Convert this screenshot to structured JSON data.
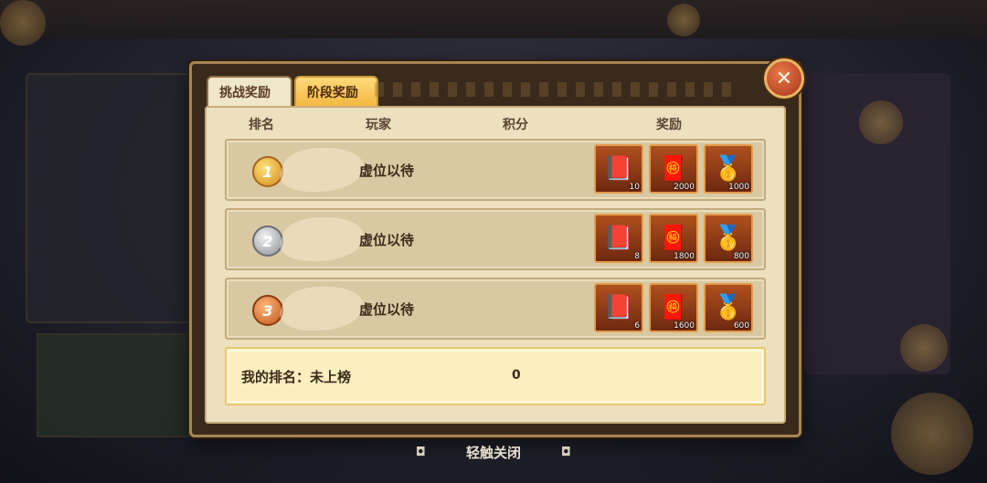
{
  "dialog": {
    "tabs": [
      {
        "label": "挑战奖励",
        "active": false
      },
      {
        "label": "阶段奖励",
        "active": true
      }
    ],
    "close_icon": "close-x-icon"
  },
  "table": {
    "headers": {
      "rank": "排名",
      "player": "玩家",
      "score": "积分",
      "reward": "奖励"
    },
    "rows": [
      {
        "rank": "1",
        "medal": "gold",
        "player": "虚位以待",
        "rewards": [
          {
            "icon": "book-icon",
            "count": "10"
          },
          {
            "icon": "red-envelope-icon",
            "count": "2000"
          },
          {
            "icon": "gold-ingot-icon",
            "count": "1000"
          }
        ]
      },
      {
        "rank": "2",
        "medal": "silver",
        "player": "虚位以待",
        "rewards": [
          {
            "icon": "book-icon",
            "count": "8"
          },
          {
            "icon": "red-envelope-icon",
            "count": "1800"
          },
          {
            "icon": "gold-ingot-icon",
            "count": "800"
          }
        ]
      },
      {
        "rank": "3",
        "medal": "bronze",
        "player": "虚位以待",
        "rewards": [
          {
            "icon": "book-icon",
            "count": "6"
          },
          {
            "icon": "red-envelope-icon",
            "count": "1600"
          },
          {
            "icon": "gold-ingot-icon",
            "count": "600"
          }
        ]
      }
    ]
  },
  "my_rank": {
    "label": "我的排名：未上榜",
    "score": "0"
  },
  "footer": {
    "close_hint": "轻触关闭"
  }
}
